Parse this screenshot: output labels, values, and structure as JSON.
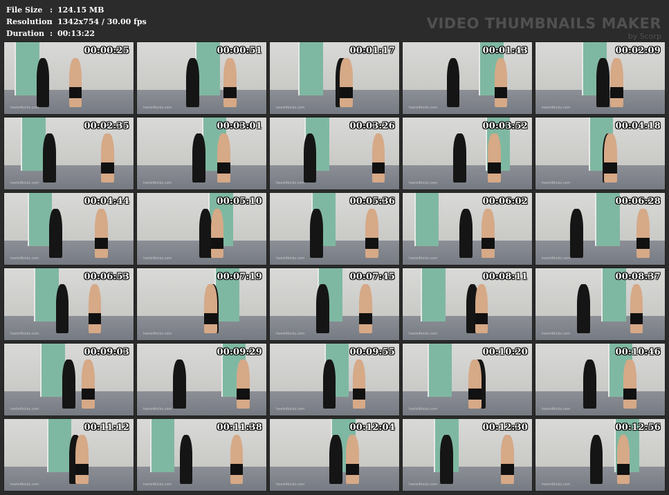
{
  "info": [
    {
      "label": "File Size",
      "value": "124.15 MB"
    },
    {
      "label": "Resolution",
      "value": "1342x754 / 30.00 fps"
    },
    {
      "label": "Duration",
      "value": "00:13:22"
    }
  ],
  "brand": {
    "title": "VIDEO THUMBNAILS MAKER",
    "subtitle": "by Scorp"
  },
  "watermark": "heels4kicks.com",
  "thumbnails": [
    "00:00:25",
    "00:00:51",
    "00:01:17",
    "00:01:43",
    "00:02:09",
    "00:02:35",
    "00:03:01",
    "00:03:26",
    "00:03:52",
    "00:04:18",
    "00:04:44",
    "00:05:10",
    "00:05:36",
    "00:06:02",
    "00:06:28",
    "00:06:53",
    "00:07:19",
    "00:07:45",
    "00:08:11",
    "00:08:37",
    "00:09:03",
    "00:09:29",
    "00:09:55",
    "00:10:20",
    "00:10:46",
    "00:11:12",
    "00:11:38",
    "00:12:04",
    "00:12:30",
    "00:12:56"
  ],
  "colors": {
    "background": "#2b2b2b",
    "text": "#ffffff",
    "brand": "#505050"
  }
}
